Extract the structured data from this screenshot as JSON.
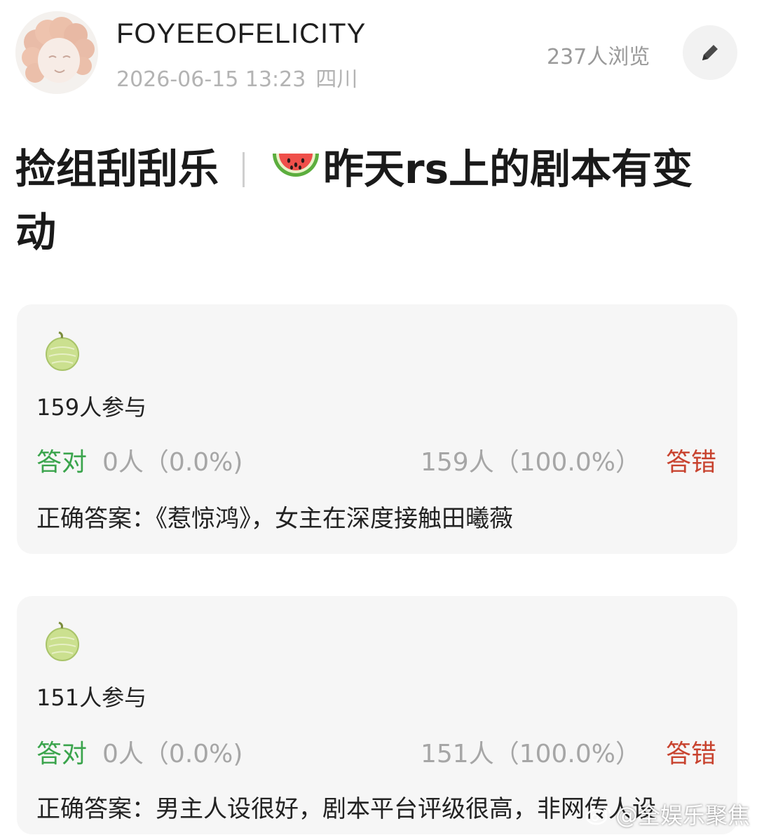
{
  "header": {
    "username": "FOYEEOFELICITY",
    "datetime": "2026-06-15 13:23",
    "location": "四川",
    "views": "237人浏览",
    "edit_icon": "pencil-icon"
  },
  "post": {
    "title_part1": "捡组刮刮乐",
    "title_emoji": "watermelon-icon",
    "title_part2": "昨天rs上的剧本有变动"
  },
  "quizzes": [
    {
      "icon": "melon-icon",
      "participants": "159人参与",
      "correct_label": "答对",
      "correct_stat": "0人（0.0%)",
      "wrong_stat": "159人（100.0%）",
      "wrong_label": "答错",
      "answer": "正确答案：《惹惊鸿》，女主在深度接触田曦薇"
    },
    {
      "icon": "melon-icon",
      "participants": "151人参与",
      "correct_label": "答对",
      "correct_stat": "0人（0.0%)",
      "wrong_stat": "151人（100.0%）",
      "wrong_label": "答错",
      "answer": "正确答案：男主人设很好，剧本平台评级很高，非网传人设"
    }
  ],
  "watermark": {
    "text": "@全娱乐聚焦",
    "icon": "weibo-icon"
  },
  "colors": {
    "correct": "#3aa44c",
    "wrong": "#c8432f",
    "card_bg": "#f6f6f6",
    "muted": "#a6a6a6"
  }
}
